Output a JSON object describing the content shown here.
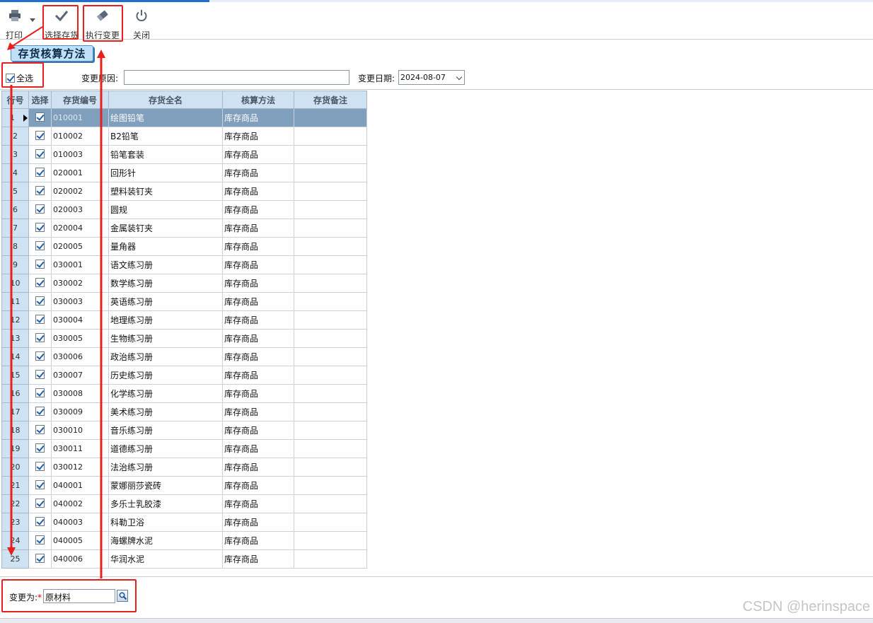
{
  "toolbar": {
    "print": "打印",
    "select_stock": "选择存货",
    "execute_change": "执行变更",
    "close": "关闭"
  },
  "page_title": "存货核算方法",
  "filter": {
    "select_all": "全选",
    "reason_label": "变更原因:",
    "reason_value": "",
    "date_label": "变更日期:",
    "date_value": "2024-08-07"
  },
  "grid": {
    "columns": [
      "行号",
      "选择",
      "存货编号",
      "存货全名",
      "核算方法",
      "存货备注"
    ],
    "rows": [
      {
        "no": "1",
        "code": "010001",
        "name": "绘图铅笔",
        "method": "库存商品",
        "note": ""
      },
      {
        "no": "2",
        "code": "010002",
        "name": "B2铅笔",
        "method": "库存商品",
        "note": ""
      },
      {
        "no": "3",
        "code": "010003",
        "name": "铅笔套装",
        "method": "库存商品",
        "note": ""
      },
      {
        "no": "4",
        "code": "020001",
        "name": "回形针",
        "method": "库存商品",
        "note": ""
      },
      {
        "no": "5",
        "code": "020002",
        "name": "塑料装钉夹",
        "method": "库存商品",
        "note": ""
      },
      {
        "no": "6",
        "code": "020003",
        "name": "圆规",
        "method": "库存商品",
        "note": ""
      },
      {
        "no": "7",
        "code": "020004",
        "name": "金属装钉夹",
        "method": "库存商品",
        "note": ""
      },
      {
        "no": "8",
        "code": "020005",
        "name": "量角器",
        "method": "库存商品",
        "note": ""
      },
      {
        "no": "9",
        "code": "030001",
        "name": "语文练习册",
        "method": "库存商品",
        "note": ""
      },
      {
        "no": "10",
        "code": "030002",
        "name": "数学练习册",
        "method": "库存商品",
        "note": ""
      },
      {
        "no": "11",
        "code": "030003",
        "name": "英语练习册",
        "method": "库存商品",
        "note": ""
      },
      {
        "no": "12",
        "code": "030004",
        "name": "地理练习册",
        "method": "库存商品",
        "note": ""
      },
      {
        "no": "13",
        "code": "030005",
        "name": "生物练习册",
        "method": "库存商品",
        "note": ""
      },
      {
        "no": "14",
        "code": "030006",
        "name": "政治练习册",
        "method": "库存商品",
        "note": ""
      },
      {
        "no": "15",
        "code": "030007",
        "name": "历史练习册",
        "method": "库存商品",
        "note": ""
      },
      {
        "no": "16",
        "code": "030008",
        "name": "化学练习册",
        "method": "库存商品",
        "note": ""
      },
      {
        "no": "17",
        "code": "030009",
        "name": "美术练习册",
        "method": "库存商品",
        "note": ""
      },
      {
        "no": "18",
        "code": "030010",
        "name": "音乐练习册",
        "method": "库存商品",
        "note": ""
      },
      {
        "no": "19",
        "code": "030011",
        "name": "道德练习册",
        "method": "库存商品",
        "note": ""
      },
      {
        "no": "20",
        "code": "030012",
        "name": "法治练习册",
        "method": "库存商品",
        "note": ""
      },
      {
        "no": "21",
        "code": "040001",
        "name": "蒙娜丽莎瓷砖",
        "method": "库存商品",
        "note": ""
      },
      {
        "no": "22",
        "code": "040002",
        "name": "多乐士乳胶漆",
        "method": "库存商品",
        "note": ""
      },
      {
        "no": "23",
        "code": "040003",
        "name": "科勒卫浴",
        "method": "库存商品",
        "note": ""
      },
      {
        "no": "24",
        "code": "040005",
        "name": "海螺牌水泥",
        "method": "库存商品",
        "note": ""
      },
      {
        "no": "25",
        "code": "040006",
        "name": "华润水泥",
        "method": "库存商品",
        "note": ""
      }
    ]
  },
  "bottom": {
    "change_to_label": "变更为:",
    "required_mark": "*",
    "change_to_value": "原材料"
  },
  "watermark": "CSDN @herinspace",
  "colors": {
    "accent": "#1e6fd0",
    "grid_header": "#cfe2f3",
    "selected_row": "#7f9fbd",
    "annotation": "#e8201c"
  },
  "icons": {
    "print": "printer-icon",
    "select_stock": "checkmark-icon",
    "execute_change": "eraser-icon",
    "close": "power-icon",
    "lookup": "search-icon"
  }
}
